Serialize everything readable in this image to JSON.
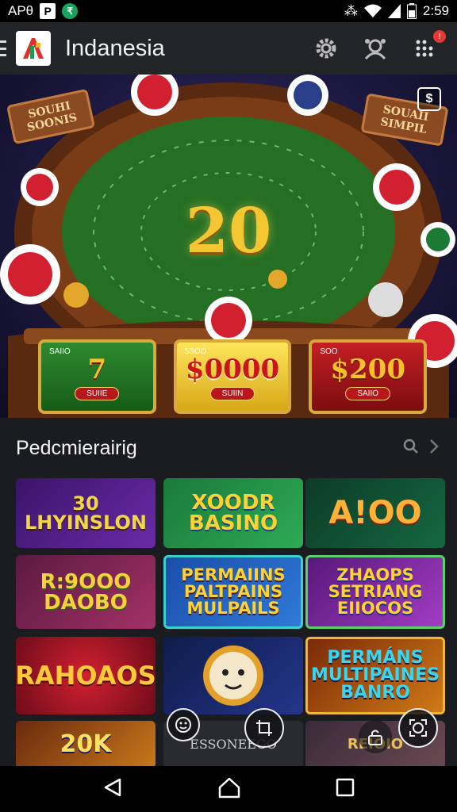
{
  "status_bar": {
    "carrier": "APθ",
    "box_icon_label": "P",
    "circle_icon_label": "₹",
    "signal_label": "⁂",
    "time": "2:59",
    "icons": [
      "signal-icon",
      "wifi-icon",
      "cell-icon",
      "battery-icon"
    ]
  },
  "app_bar": {
    "title": "Indanesia",
    "menu_icon": "hamburger-icon",
    "logo_icon": "app-logo-icon",
    "actions": [
      "settings-icon",
      "support-icon",
      "grid-menu-icon"
    ],
    "badge": "!"
  },
  "hero": {
    "jackpot_number": "20",
    "left_sign": "SOUHI\nSOONIS",
    "right_sign": "SOUAII\nSIMPIL",
    "corner_badge": "$",
    "reels": [
      {
        "tag": "SAIIO",
        "value": "7",
        "button": "SUIIE"
      },
      {
        "tag": "$SOO",
        "value": "$0000",
        "button": "SUIIN"
      },
      {
        "tag": "SOO",
        "value": "$200",
        "button": "SAIIO"
      }
    ],
    "colors": {
      "felt": "#2f8a2f",
      "gold": "#f3c632",
      "wood": "#6a3414"
    }
  },
  "section": {
    "title": "Pedcmierairig",
    "search_icon": "search-icon",
    "next_icon": "chevron-right-icon"
  },
  "games": [
    {
      "title": "30 LHYINSLON"
    },
    {
      "title": "XOODR BASINO"
    },
    {
      "title": "A!OO"
    },
    {
      "title": "R:9OOO DAOBO"
    },
    {
      "title": "PERMAIINS PALTPAINS MULPAILS"
    },
    {
      "title": "ZHAOPS SETRIANG EIIOCOS"
    },
    {
      "title": "RAHOAOS"
    },
    {
      "title": ""
    },
    {
      "title": "PERMÁNS MULTIPAINES BANRO"
    },
    {
      "title": "20K"
    },
    {
      "title": "ESSONEEGO"
    },
    {
      "title": "REIOIO"
    }
  ],
  "floating_controls": [
    "emoji-icon",
    "crop-icon",
    "lock-icon",
    "scan-icon"
  ],
  "nav_bar": [
    "back-icon",
    "home-icon",
    "recents-icon"
  ]
}
